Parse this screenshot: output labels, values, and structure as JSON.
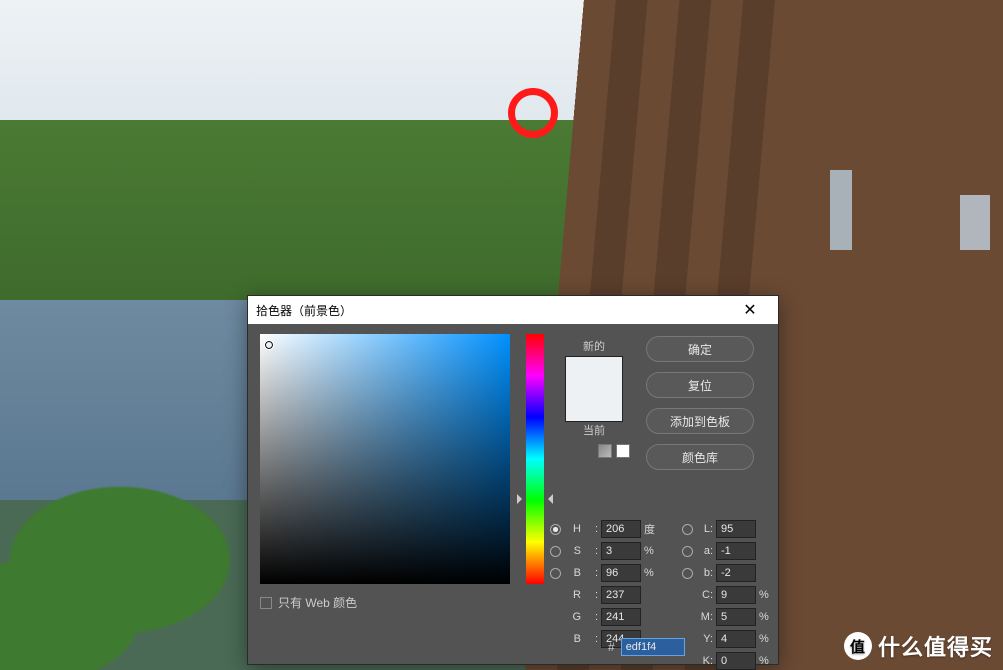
{
  "dialog": {
    "title": "拾色器（前景色）",
    "close_label": "✕",
    "new_label": "新的",
    "current_label": "当前",
    "only_web_label": "只有 Web 颜色",
    "buttons": {
      "ok": "确定",
      "reset": "复位",
      "add_swatch": "添加到色板",
      "libraries": "颜色库"
    },
    "fields": {
      "H": {
        "label": "H",
        "value": "206",
        "unit": "度"
      },
      "S": {
        "label": "S",
        "value": "3",
        "unit": "%"
      },
      "Bb": {
        "label": "B",
        "value": "96",
        "unit": "%"
      },
      "L": {
        "label": "L",
        "value": "95",
        "unit": ""
      },
      "a": {
        "label": "a",
        "value": "-1",
        "unit": ""
      },
      "b2": {
        "label": "b",
        "value": "-2",
        "unit": ""
      },
      "R": {
        "label": "R",
        "value": "237",
        "unit": ""
      },
      "G": {
        "label": "G",
        "value": "241",
        "unit": ""
      },
      "B": {
        "label": "B",
        "value": "244",
        "unit": ""
      },
      "C": {
        "label": "C",
        "value": "9",
        "unit": "%"
      },
      "M": {
        "label": "M",
        "value": "5",
        "unit": "%"
      },
      "Y": {
        "label": "Y",
        "value": "4",
        "unit": "%"
      },
      "K": {
        "label": "K",
        "value": "0",
        "unit": "%"
      }
    },
    "hex": {
      "prefix": "#",
      "value": "edf1f4"
    },
    "colors": {
      "new": "#edf1f4",
      "current": "#edf1f4",
      "hue_deg": 206
    }
  },
  "watermark": {
    "badge": "值",
    "text": "什么值得买"
  }
}
